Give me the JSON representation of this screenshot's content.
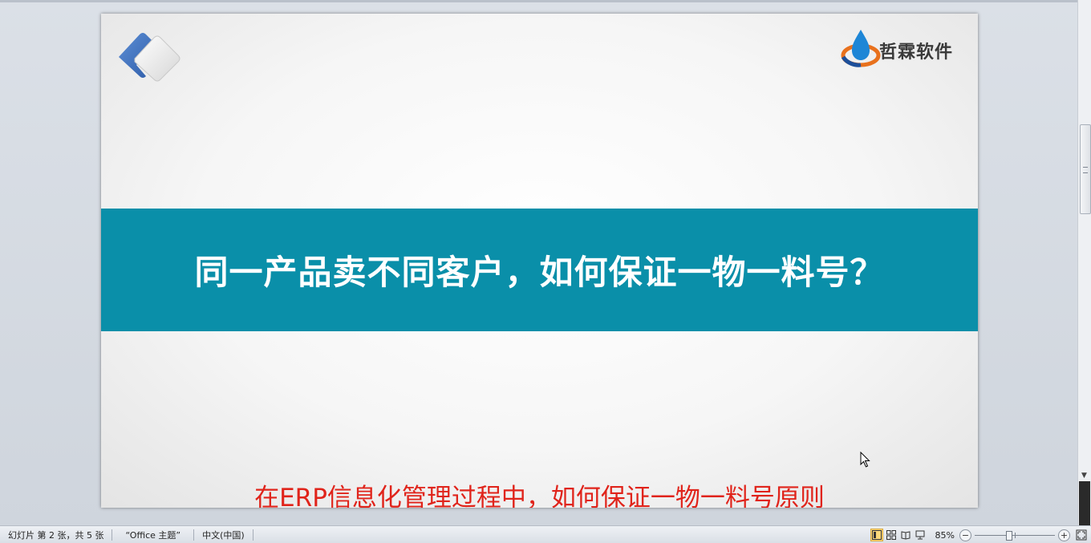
{
  "slide": {
    "logo_text": "哲霖软件",
    "band_title": "同一产品卖不同客户，如何保证一物一料号？",
    "subtitle": "在ERP信息化管理过程中，如何保证一物一料号原则",
    "band_color": "#0a8fa9",
    "subtitle_color": "#e0241b"
  },
  "statusbar": {
    "slide_info": "幻灯片 第 2 张，共 5 张",
    "theme": "“Office 主题”",
    "language": "中文(中国)",
    "zoom_label": "85%",
    "zoom_level_percent": 85,
    "zoom_out": "−",
    "zoom_in": "+"
  },
  "icons": {
    "view_normal": "normal-view-icon",
    "view_sorter": "slide-sorter-icon",
    "view_reading": "reading-view-icon",
    "view_show": "slideshow-icon",
    "fit": "fit-window-icon"
  }
}
